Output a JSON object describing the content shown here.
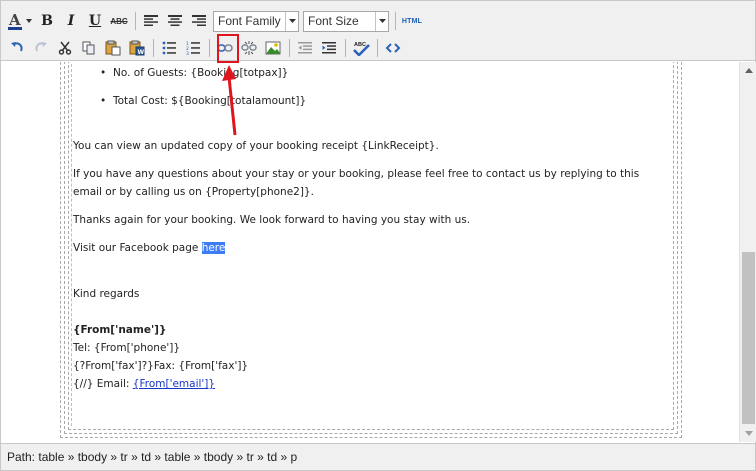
{
  "toolbar": {
    "font_family_label": "Font Family",
    "font_size_label": "Font Size",
    "bold_label": "B",
    "italic_label": "I",
    "underline_label": "U",
    "strike_label": "ABC",
    "html_label": "HTML",
    "highlighted_button": "insert-link"
  },
  "content": {
    "guests_line": "No. of Guests: {Booking[totpax]}",
    "total_line": "Total Cost: ${Booking[totalamount]}",
    "receipt_line": "You can view an updated copy of your booking receipt {LinkReceipt}.",
    "questions_line": "If you have any questions about your stay or your booking, please feel free to contact us by replying to this email or by calling us on {Property[phone2]}.",
    "thanks_line": "Thanks again for your booking. We look forward to having you stay with us.",
    "facebook_prefix": "Visit our Facebook page ",
    "facebook_link": "here",
    "regards_line": "Kind regards",
    "from_name": "{From['name']}",
    "tel_line": "Tel: {From['phone']}",
    "fax_line": "{?From['fax']?}Fax: {From['fax']}",
    "email_prefix": "{//} Email: ",
    "email_link": "{From['email']}"
  },
  "status": {
    "path": "Path: table » tbody » tr » td » table » tbody » tr » td » p"
  },
  "colors": {
    "highlight_red": "#e0141e",
    "selection_blue": "#3d7cf5",
    "link_blue": "#1a36c7"
  }
}
